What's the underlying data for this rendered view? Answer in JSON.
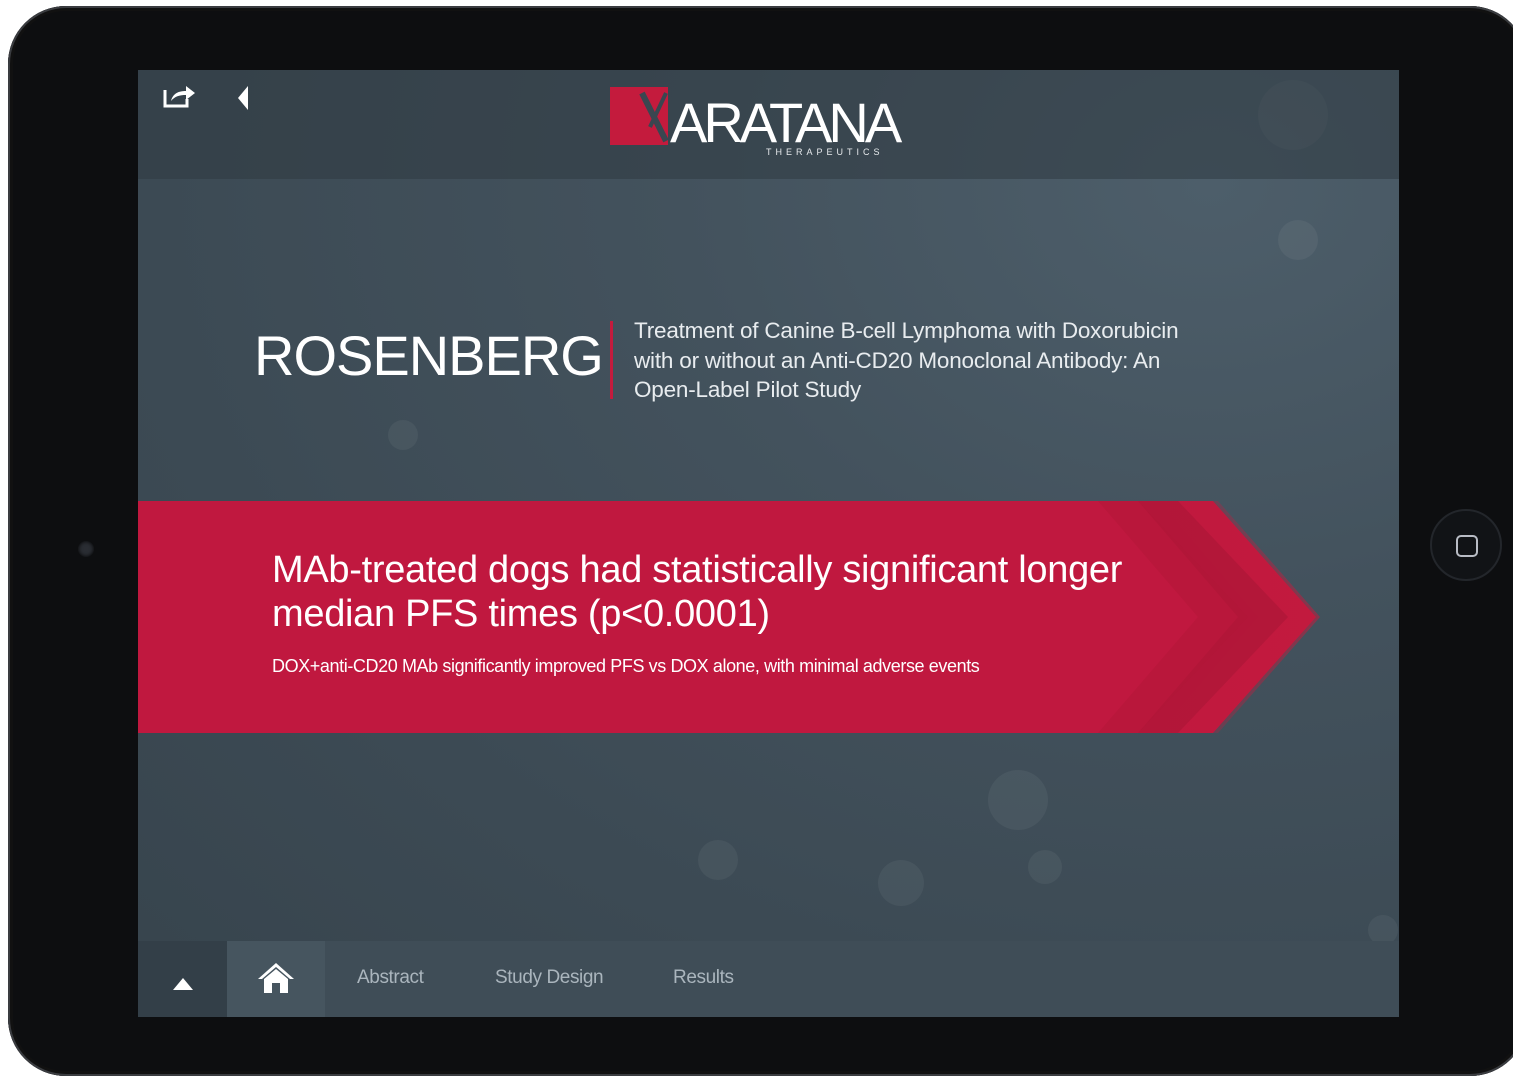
{
  "toolbar": {
    "share_icon": "share-icon",
    "back_icon": "back-triangle-icon"
  },
  "logo": {
    "name": "ARATANA",
    "tagline": "THERAPEUTICS"
  },
  "study": {
    "author": "ROSENBERG",
    "title": "Treatment of Canine B-cell Lymphoma with Doxorubicin with or without an Anti-CD20 Monoclonal Antibody: An Open-Label Pilot Study"
  },
  "banner": {
    "headline": "MAb-treated dogs had statistically significant longer median PFS times (p<0.0001)",
    "subline": "DOX+anti-CD20 MAb significantly improved PFS vs DOX alone, with minimal adverse events"
  },
  "bottom_nav": {
    "up_icon": "up-triangle-icon",
    "home_icon": "home-icon",
    "items": [
      {
        "label": "Abstract"
      },
      {
        "label": "Study Design"
      },
      {
        "label": "Results"
      }
    ]
  },
  "colors": {
    "accent": "#c41b3d",
    "screen_bg": "#3f4d57"
  }
}
